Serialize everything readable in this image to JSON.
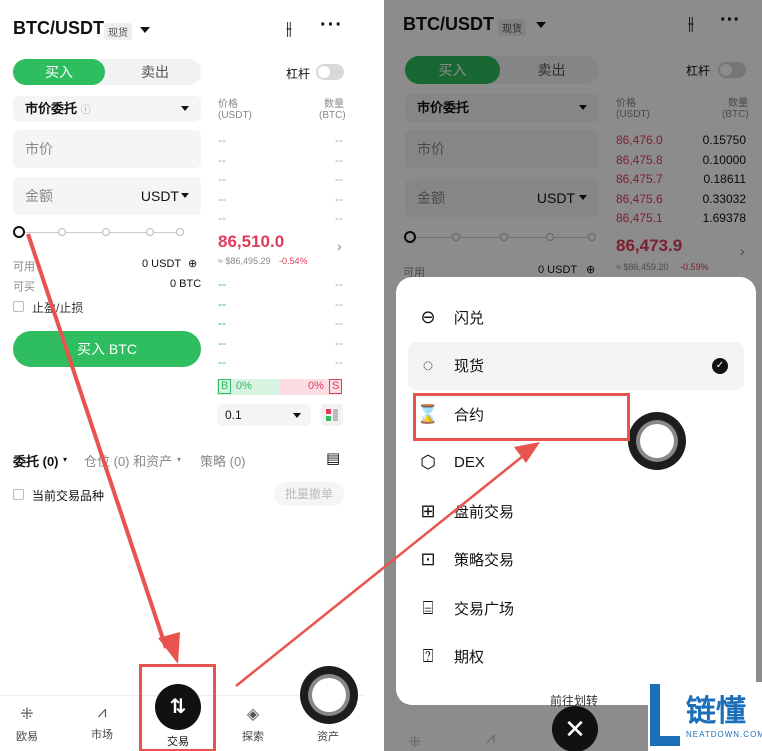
{
  "left": {
    "pair": "BTC/USDT",
    "market_tag": "现货",
    "buy_tab": "买入",
    "sell_tab": "卖出",
    "leverage_label": "杠杆",
    "order_type": "市价委托",
    "price_placeholder": "市价",
    "amount_placeholder": "金额",
    "amount_unit": "USDT",
    "available_label": "可用",
    "available_value": "0 USDT",
    "can_buy_label": "可买",
    "can_buy_value": "0 BTC",
    "tpsl_label": "止盈/止损",
    "buy_button": "买入 BTC",
    "book_price_header": "价格",
    "book_price_unit": "(USDT)",
    "book_qty_header": "数量",
    "book_qty_unit": "(BTC)",
    "dash": "--",
    "last_price": "86,510.0",
    "last_price_sub": "≈ $86,495.29",
    "last_change": "-0.54%",
    "buy_ratio_letter": "B",
    "buy_ratio": "0%",
    "sell_ratio": "0%",
    "sell_ratio_letter": "S",
    "depth_step": "0.1",
    "orders_tab": "委托 (0)",
    "positions_tab": "仓位 (0) 和资产",
    "strategy_tab": "策略 (0)",
    "current_pair_label": "当前交易品种",
    "batch_cancel": "批量撤单",
    "nav": [
      "欧易",
      "市场",
      "交易",
      "探索",
      "资产"
    ]
  },
  "right": {
    "pair": "BTC/USDT",
    "market_tag": "现货",
    "buy_tab": "买入",
    "sell_tab": "卖出",
    "leverage_label": "杠杆",
    "order_type": "市价委托",
    "price_placeholder": "市价",
    "amount_placeholder": "金额",
    "amount_unit": "USDT",
    "available_label": "可用",
    "available_value": "0 USDT",
    "book_price_header": "价格",
    "book_price_unit": "(USDT)",
    "book_qty_header": "数量",
    "book_qty_unit": "(BTC)",
    "asks": [
      {
        "price": "86,476.0",
        "qty": "0.15750"
      },
      {
        "price": "86,475.8",
        "qty": "0.10000"
      },
      {
        "price": "86,475.7",
        "qty": "0.18611"
      },
      {
        "price": "86,475.6",
        "qty": "0.33032"
      },
      {
        "price": "86,475.1",
        "qty": "1.69378"
      }
    ],
    "last_price": "86,473.9",
    "last_price_sub": "≈ $86,459.20",
    "last_change": "-0.59%",
    "menu": [
      {
        "label": "闪兑",
        "icon": "swap-circle-icon"
      },
      {
        "label": "现货",
        "icon": "spot-icon"
      },
      {
        "label": "合约",
        "icon": "contract-icon"
      },
      {
        "label": "DEX",
        "icon": "cube-icon"
      },
      {
        "label": "盘前交易",
        "icon": "premarket-icon"
      },
      {
        "label": "策略交易",
        "icon": "bot-icon"
      },
      {
        "label": "交易广场",
        "icon": "square-icon"
      },
      {
        "label": "期权",
        "icon": "options-icon"
      }
    ],
    "transfer_label": "前往划转"
  },
  "watermark": {
    "brand": "链懂",
    "url": "NEATDOWN.COM"
  },
  "colors": {
    "green": "#2ebd5f",
    "red": "#e23b5a",
    "annotation": "#e8534e"
  }
}
